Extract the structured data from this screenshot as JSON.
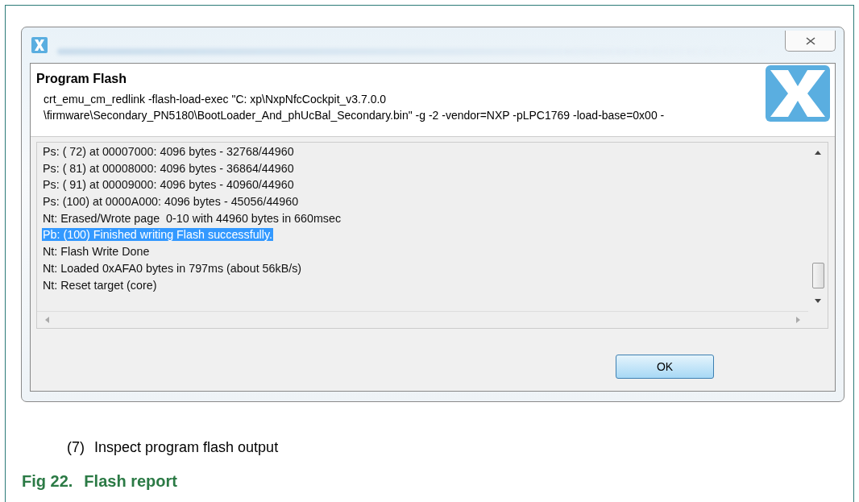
{
  "dialog": {
    "title": "Program Flash",
    "message_lines": [
      "crt_emu_cm_redlink -flash-load-exec \"C: xp\\NxpNfcCockpit_v3.7.0.0",
      "\\firmware\\Secondary_PN5180\\BootLoader_And_phUcBal_Secondary.bin\" -g -2 -vendor=NXP -pLPC1769 -load-base=0x00 -"
    ],
    "log": [
      {
        "text": "Ps: ( 72) at 00007000: 4096 bytes - 32768/44960",
        "selected": false
      },
      {
        "text": "Ps: ( 81) at 00008000: 4096 bytes - 36864/44960",
        "selected": false
      },
      {
        "text": "Ps: ( 91) at 00009000: 4096 bytes - 40960/44960",
        "selected": false
      },
      {
        "text": "Ps: (100) at 0000A000: 4096 bytes - 45056/44960",
        "selected": false
      },
      {
        "text": "Nt: Erased/Wrote page  0-10 with 44960 bytes in 660msec",
        "selected": false
      },
      {
        "text": "Pb: (100) Finished writing Flash successfully.",
        "selected": true
      },
      {
        "text": "Nt: Flash Write Done",
        "selected": false
      },
      {
        "text": "Nt: Loaded 0xAFA0 bytes in 797ms (about 56kB/s)",
        "selected": false
      },
      {
        "text": "Nt: Reset target (core)",
        "selected": false
      }
    ],
    "buttons": [
      "OK"
    ]
  },
  "caption": {
    "number": "(7)",
    "text": "Inspect program flash output"
  },
  "figure": {
    "label": "Fig 22.",
    "title": "Flash report"
  }
}
